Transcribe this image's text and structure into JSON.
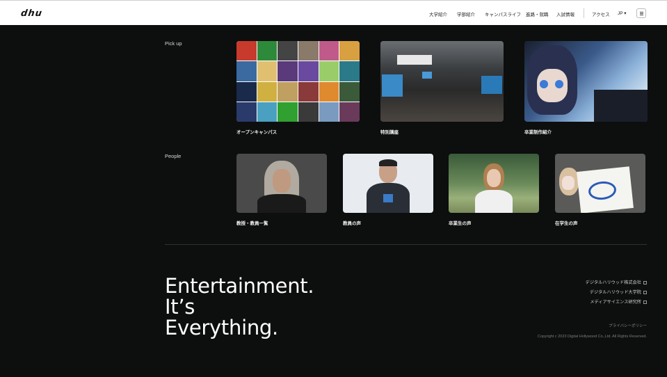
{
  "header": {
    "logo": "dhu",
    "nav": [
      "大学紹介",
      "学部紹介",
      "キャンパスライフ",
      "進路・就職",
      "入試情報"
    ],
    "access": "アクセス",
    "lang": "JP ▾"
  },
  "pickup": {
    "label": "Pick up",
    "items": [
      {
        "title": "オープンキャンパス"
      },
      {
        "title": "特別講座"
      },
      {
        "title": "卒業制作紹介"
      }
    ]
  },
  "people": {
    "label": "People",
    "items": [
      {
        "title": "教授・教員一覧"
      },
      {
        "title": "教員の声"
      },
      {
        "title": "卒業生の声"
      },
      {
        "title": "在学生の声"
      }
    ]
  },
  "tagline": [
    "Entertainment.",
    "It’s",
    "Everything."
  ],
  "footer": {
    "links": [
      "デジタルハリウッド株式会社",
      "デジタルハリウッド大学院",
      "メディアサイエンス研究所"
    ],
    "privacy": "プライバシーポリシー",
    "copyright": "Copyright c 2023 Digital Hollywood Co.,Ltd. All Rights Reserved."
  },
  "colors": {
    "background": "#0d0e0e",
    "header": "#ffffff",
    "text": "#ffffff"
  }
}
